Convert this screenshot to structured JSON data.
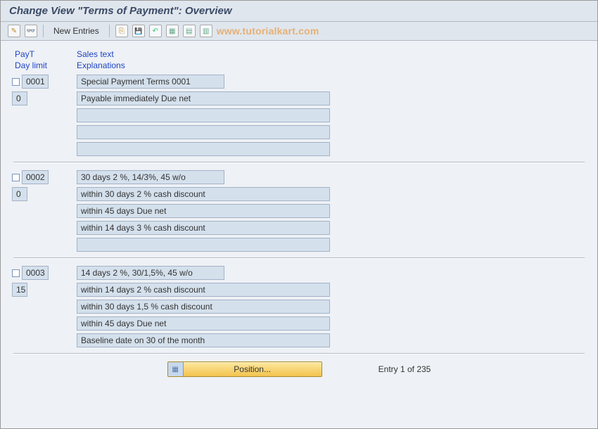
{
  "title": "Change View \"Terms of Payment\": Overview",
  "toolbar": {
    "new_entries": "New Entries",
    "watermark": "www.tutorialkart.com"
  },
  "headers": {
    "payt": "PayT",
    "sales_text": "Sales text",
    "day_limit": "Day limit",
    "explanations": "Explanations"
  },
  "entries": [
    {
      "payt": "0001",
      "day_limit": "0",
      "sales_text": "Special Payment Terms 0001",
      "explanations": [
        "Payable immediately Due net",
        "",
        "",
        ""
      ]
    },
    {
      "payt": "0002",
      "day_limit": "0",
      "sales_text": "30 days 2 %, 14/3%, 45 w/o",
      "explanations": [
        "within 30 days 2 % cash discount",
        "within 45 days Due net",
        "within 14 days 3 % cash discount",
        ""
      ]
    },
    {
      "payt": "0003",
      "day_limit": "15",
      "sales_text": "14 days 2 %, 30/1,5%, 45 w/o",
      "explanations": [
        "within 14 days 2 % cash discount",
        "within 30 days 1,5 % cash discount",
        "within 45 days Due net",
        "Baseline date on 30 of the month"
      ]
    }
  ],
  "footer": {
    "position_label": "Position...",
    "entry_text": "Entry 1 of 235"
  }
}
